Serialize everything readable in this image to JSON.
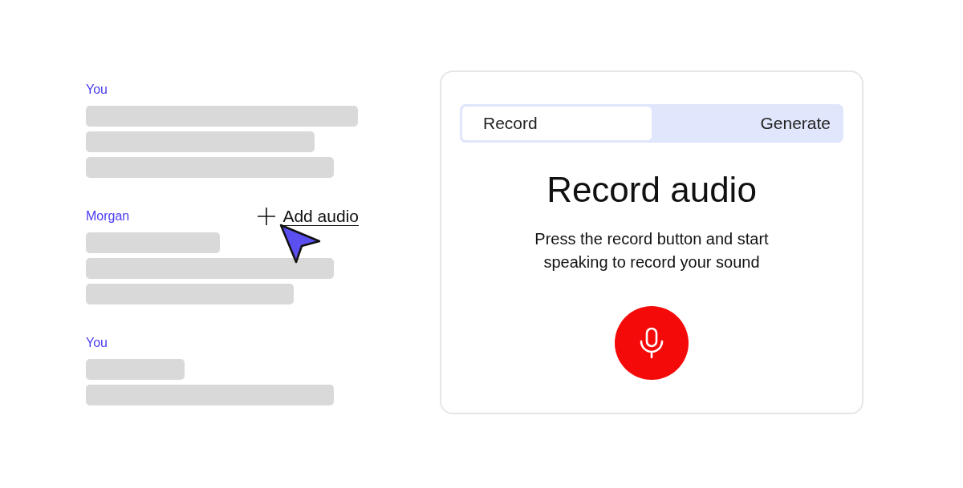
{
  "conversation": [
    {
      "speaker": "You"
    },
    {
      "speaker": "Morgan",
      "action": {
        "label": "Add audio"
      }
    },
    {
      "speaker": "You"
    }
  ],
  "panel": {
    "tabs": [
      {
        "label": "Record",
        "selected": true
      },
      {
        "label": "Generate",
        "selected": false
      }
    ],
    "title": "Record audio",
    "description": "Press the record button and start speaking to record your sound"
  }
}
